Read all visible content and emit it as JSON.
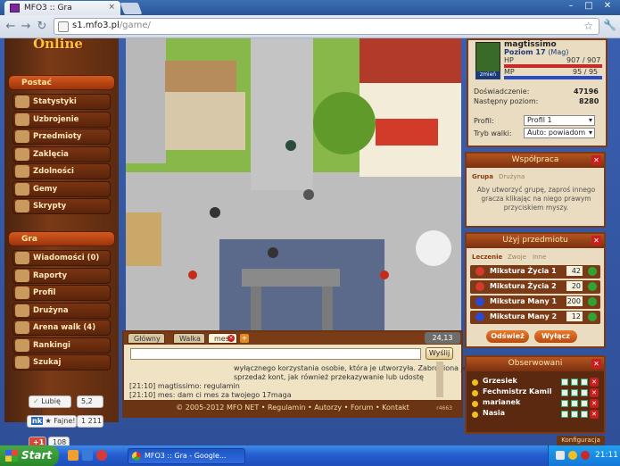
{
  "browser": {
    "tab_title": "MFO3 :: Gra",
    "url_host": "s1.mfo3.pl",
    "url_path": "/game/"
  },
  "left_menu": {
    "logo": "Online",
    "postac_header": "Postać",
    "postac_items": [
      "Statystyki",
      "Uzbrojenie",
      "Przedmioty",
      "Zaklęcia",
      "Zdolności",
      "Gemy",
      "Skrypty"
    ],
    "gra_header": "Gra",
    "gra_items": [
      "Wiadomości (0)",
      "Raporty",
      "Profil",
      "Drużyna",
      "Arena walk (4)",
      "Rankingi",
      "Szukaj"
    ]
  },
  "chat": {
    "tabs": [
      "Główny",
      "Walka",
      "mes"
    ],
    "coords": "24,13",
    "send_label": "Wyślij",
    "lines": [
      "wyłącznego korzystania osobie, która je utworzyła. Zabroniona jest",
      "sprzedaż kont, jak również przekazywanie lub udostę",
      "[21:10] magtissimo: regulamin",
      "[21:10] mes: dam ci mes za twojego 17maga"
    ]
  },
  "footer": {
    "copyright": "© 2005-2012 MFO NET",
    "links": [
      "Regulamin",
      "Autorzy",
      "Forum",
      "Kontakt"
    ],
    "version": "r4663"
  },
  "profile": {
    "name": "magtissimo",
    "level": "Poziom 17",
    "class": "(Mag)",
    "hp_label": "HP",
    "hp_value": "907 / 907",
    "mp_label": "MP",
    "mp_value": "95 / 95",
    "avatar_badge": "zmień",
    "exp_label": "Doświadczenie:",
    "exp_value": "47196",
    "next_label": "Następny poziom:",
    "next_value": "8280",
    "profil_label": "Profil:",
    "profil_value": "Profil 1",
    "tryb_label": "Tryb walki:",
    "tryb_value": "Auto: powiadom",
    "hp_fraction": 1.0,
    "mp_fraction": 1.0
  },
  "wspolpraca": {
    "title": "Współpraca",
    "tabs": [
      "Grupa",
      "Drużyna"
    ],
    "text": "Aby utworzyć grupę, zaproś innego gracza klikając na niego prawym przyciskiem myszy."
  },
  "items_panel": {
    "title": "Użyj przedmiotu",
    "tabs": [
      "Leczenie",
      "Zwoje",
      "Inne"
    ],
    "items": [
      {
        "name": "Mikstura Życia 1",
        "qty": "42",
        "color": "#d23a2a"
      },
      {
        "name": "Mikstura Życia 2",
        "qty": "20",
        "color": "#d23a2a"
      },
      {
        "name": "Mikstura Many 1",
        "qty": "200",
        "color": "#2a4ad2"
      },
      {
        "name": "Mikstura Many 2",
        "qty": "12",
        "color": "#2a4ad2"
      }
    ],
    "refresh_label": "Odśwież",
    "off_label": "Wyłącz"
  },
  "observed": {
    "title": "Obserwowani",
    "people": [
      "Grzesiek",
      "Fechmistrz Kamil",
      "marianek",
      "Nasia"
    ]
  },
  "konfig_label": "Konfiguracja",
  "social": {
    "like_label": "Lubię to!",
    "like_count": "5,2",
    "nk_label": "Fajne!",
    "nk_count": "1 211",
    "plus_label": "+1",
    "plus_count": "108"
  },
  "taskbar": {
    "start_label": "Start",
    "window_label": "MFO3 :: Gra - Google...",
    "clock": "21:11"
  }
}
